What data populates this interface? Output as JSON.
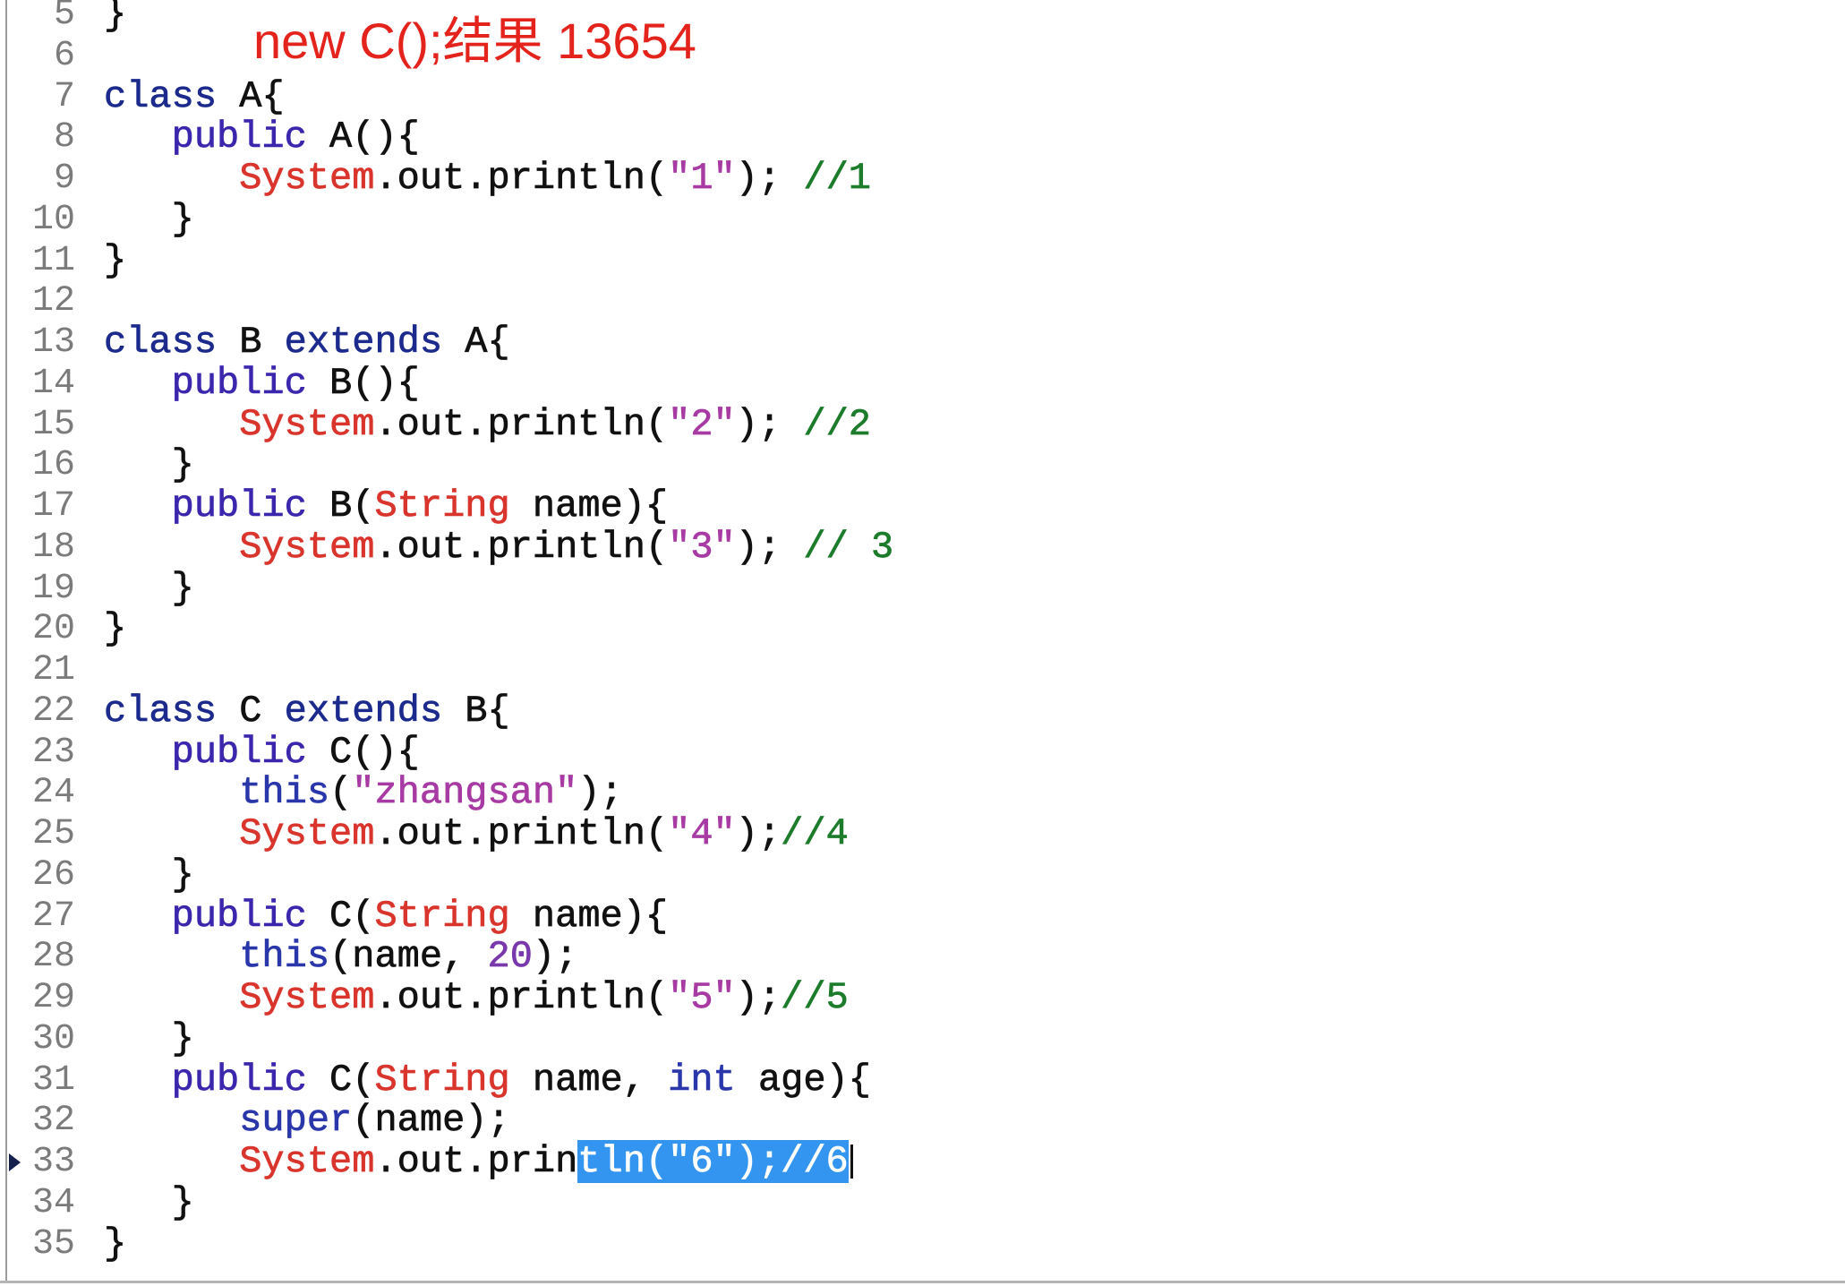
{
  "annotation": {
    "text": "new C();结果 13654",
    "color": "#e3231c"
  },
  "theme": {
    "background": "#ffffff",
    "text_color": "#111111",
    "line_number_color": "#7b7b7b",
    "selection_color": "#3395f0",
    "selected_text_color": "#ffffff"
  },
  "editor": {
    "lines": [
      {
        "number": "5",
        "tokens": [
          {
            "text": "}"
          }
        ]
      },
      {
        "number": "6",
        "tokens": []
      },
      {
        "number": "7",
        "tokens": [
          {
            "text": "class",
            "color": "#1b2a8c"
          },
          {
            "text": " A{"
          }
        ]
      },
      {
        "number": "8",
        "tokens": [
          {
            "text": "   public",
            "color": "#3b27ad"
          },
          {
            "text": " A(){"
          }
        ]
      },
      {
        "number": "9",
        "tokens": [
          {
            "text": "      System",
            "color": "#d9352d"
          },
          {
            "text": ".out.println("
          },
          {
            "text": "\"1\"",
            "color": "#a83aa4"
          },
          {
            "text": "); "
          },
          {
            "text": "//1",
            "color": "#1c7c2b"
          }
        ]
      },
      {
        "number": "10",
        "tokens": [
          {
            "text": "   }"
          }
        ]
      },
      {
        "number": "11",
        "tokens": [
          {
            "text": "}"
          }
        ]
      },
      {
        "number": "12",
        "tokens": []
      },
      {
        "number": "13",
        "tokens": [
          {
            "text": "class",
            "color": "#1b2a8c"
          },
          {
            "text": " B "
          },
          {
            "text": "extends",
            "color": "#1b2a8c"
          },
          {
            "text": " A{"
          }
        ]
      },
      {
        "number": "14",
        "tokens": [
          {
            "text": "   public",
            "color": "#3b27ad"
          },
          {
            "text": " B(){"
          }
        ]
      },
      {
        "number": "15",
        "tokens": [
          {
            "text": "      System",
            "color": "#d9352d"
          },
          {
            "text": ".out.println("
          },
          {
            "text": "\"2\"",
            "color": "#a83aa4"
          },
          {
            "text": "); "
          },
          {
            "text": "//2",
            "color": "#1c7c2b"
          }
        ]
      },
      {
        "number": "16",
        "tokens": [
          {
            "text": "   }"
          }
        ]
      },
      {
        "number": "17",
        "tokens": [
          {
            "text": "   public",
            "color": "#3b27ad"
          },
          {
            "text": " B("
          },
          {
            "text": "String",
            "color": "#d9352d"
          },
          {
            "text": " name){"
          }
        ]
      },
      {
        "number": "18",
        "tokens": [
          {
            "text": "      System",
            "color": "#d9352d"
          },
          {
            "text": ".out.println("
          },
          {
            "text": "\"3\"",
            "color": "#a83aa4"
          },
          {
            "text": "); "
          },
          {
            "text": "// 3",
            "color": "#1c7c2b"
          }
        ]
      },
      {
        "number": "19",
        "tokens": [
          {
            "text": "   }"
          }
        ]
      },
      {
        "number": "20",
        "tokens": [
          {
            "text": "}"
          }
        ]
      },
      {
        "number": "21",
        "tokens": []
      },
      {
        "number": "22",
        "tokens": [
          {
            "text": "class",
            "color": "#1b2a8c"
          },
          {
            "text": " C "
          },
          {
            "text": "extends",
            "color": "#1b2a8c"
          },
          {
            "text": " B{"
          }
        ]
      },
      {
        "number": "23",
        "tokens": [
          {
            "text": "   public",
            "color": "#3b27ad"
          },
          {
            "text": " C(){"
          }
        ]
      },
      {
        "number": "24",
        "tokens": [
          {
            "text": "      this",
            "color": "#2a37ab"
          },
          {
            "text": "("
          },
          {
            "text": "\"zhangsan\"",
            "color": "#a83aa4"
          },
          {
            "text": ");"
          }
        ]
      },
      {
        "number": "25",
        "tokens": [
          {
            "text": "      System",
            "color": "#d9352d"
          },
          {
            "text": ".out.println("
          },
          {
            "text": "\"4\"",
            "color": "#a83aa4"
          },
          {
            "text": ");"
          },
          {
            "text": "//4",
            "color": "#1c7c2b"
          }
        ]
      },
      {
        "number": "26",
        "tokens": [
          {
            "text": "   }"
          }
        ]
      },
      {
        "number": "27",
        "tokens": [
          {
            "text": "   public",
            "color": "#3b27ad"
          },
          {
            "text": " C("
          },
          {
            "text": "String",
            "color": "#d9352d"
          },
          {
            "text": " name){"
          }
        ]
      },
      {
        "number": "28",
        "tokens": [
          {
            "text": "      this",
            "color": "#2a37ab"
          },
          {
            "text": "(name, "
          },
          {
            "text": "20",
            "color": "#7a38ad"
          },
          {
            "text": ");"
          }
        ]
      },
      {
        "number": "29",
        "tokens": [
          {
            "text": "      System",
            "color": "#d9352d"
          },
          {
            "text": ".out.println("
          },
          {
            "text": "\"5\"",
            "color": "#a83aa4"
          },
          {
            "text": ");"
          },
          {
            "text": "//5",
            "color": "#1c7c2b"
          }
        ]
      },
      {
        "number": "30",
        "tokens": [
          {
            "text": "   }"
          }
        ]
      },
      {
        "number": "31",
        "tokens": [
          {
            "text": "   public",
            "color": "#3b27ad"
          },
          {
            "text": " C("
          },
          {
            "text": "String",
            "color": "#d9352d"
          },
          {
            "text": " name, "
          },
          {
            "text": "int",
            "color": "#2a37ab"
          },
          {
            "text": " age){"
          }
        ]
      },
      {
        "number": "32",
        "tokens": [
          {
            "text": "      super",
            "color": "#2a37ab"
          },
          {
            "text": "(name);"
          }
        ]
      },
      {
        "number": "33",
        "marker": true,
        "caret": true,
        "tokens": [
          {
            "text": "      System",
            "color": "#d9352d"
          },
          {
            "text": ".out.prin"
          },
          {
            "text": "tln(\"6\");//6",
            "color": "#ffffff",
            "bg": "#3395f0"
          }
        ]
      },
      {
        "number": "34",
        "tokens": [
          {
            "text": "   }"
          }
        ]
      },
      {
        "number": "35",
        "tokens": [
          {
            "text": "}"
          }
        ]
      }
    ]
  }
}
